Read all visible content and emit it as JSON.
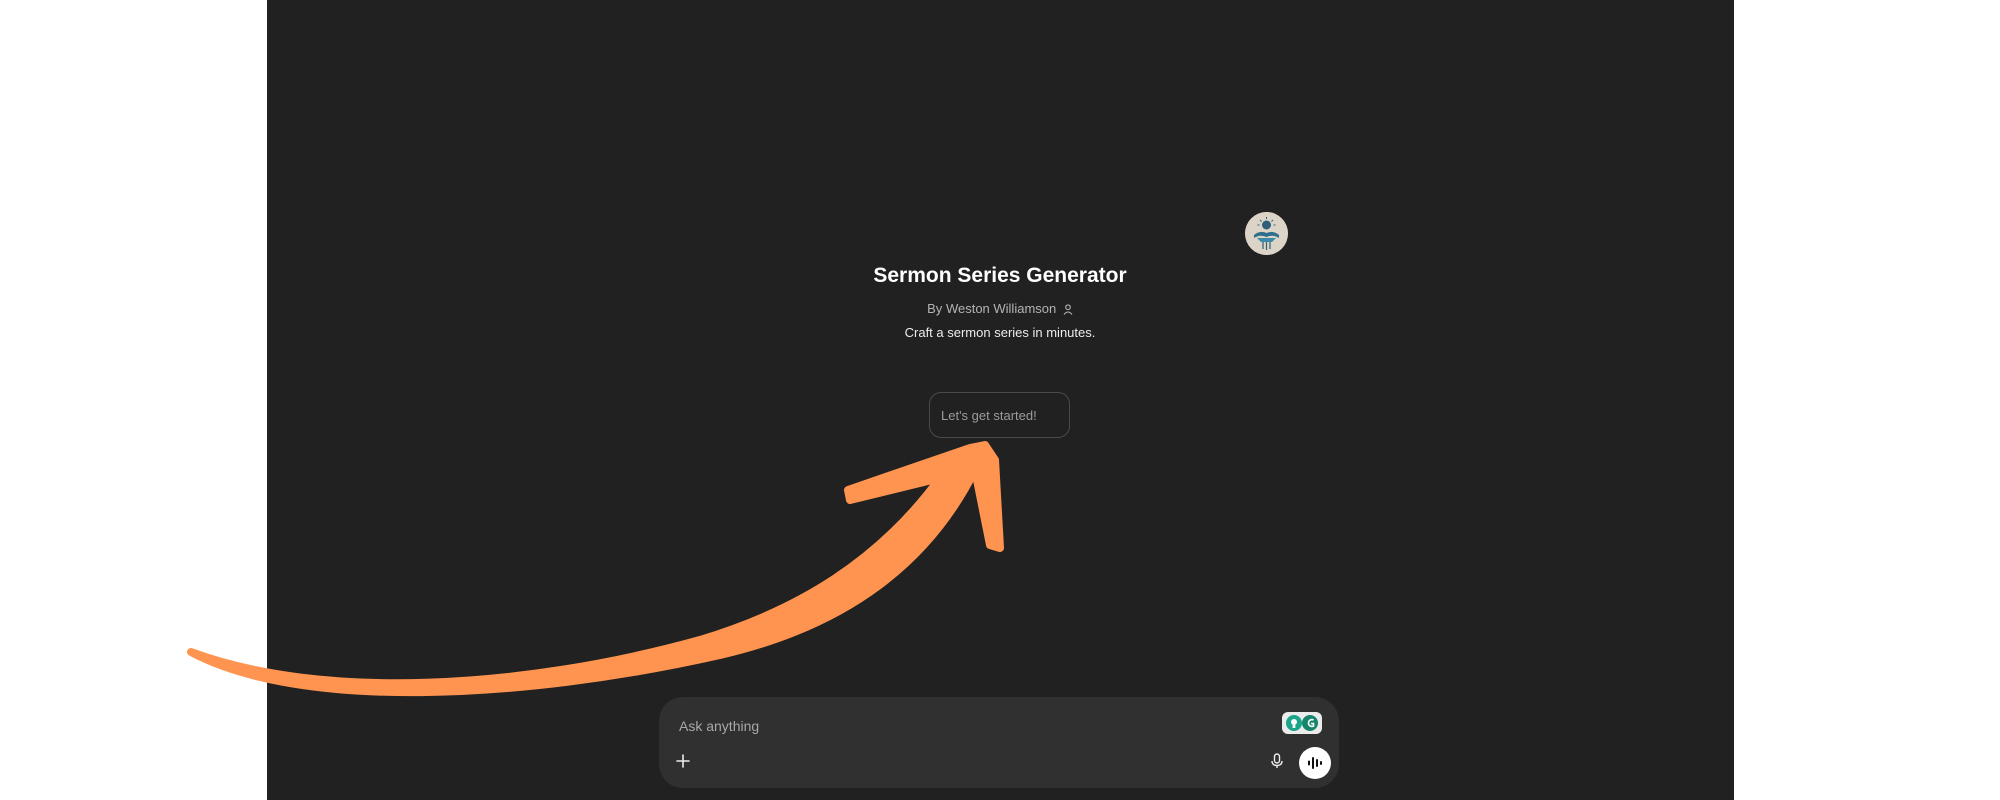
{
  "gpt": {
    "name": "Sermon Series Generator",
    "by_prefix": "By",
    "author": "Weston Williamson",
    "description": "Craft a sermon series in minutes."
  },
  "conversation_starters": [
    "Let's get started!"
  ],
  "composer": {
    "placeholder": "Ask anything",
    "icons": {
      "attach": "plus-icon",
      "extension": "extension-badge-icon",
      "dictate": "microphone-icon",
      "voice": "voice-mode-icon"
    }
  },
  "colors": {
    "background": "#212121",
    "page_margin": "#ffffff",
    "composer": "#303030",
    "annotation_arrow": "#ff9450",
    "extension_badge": "#1aa58a"
  }
}
